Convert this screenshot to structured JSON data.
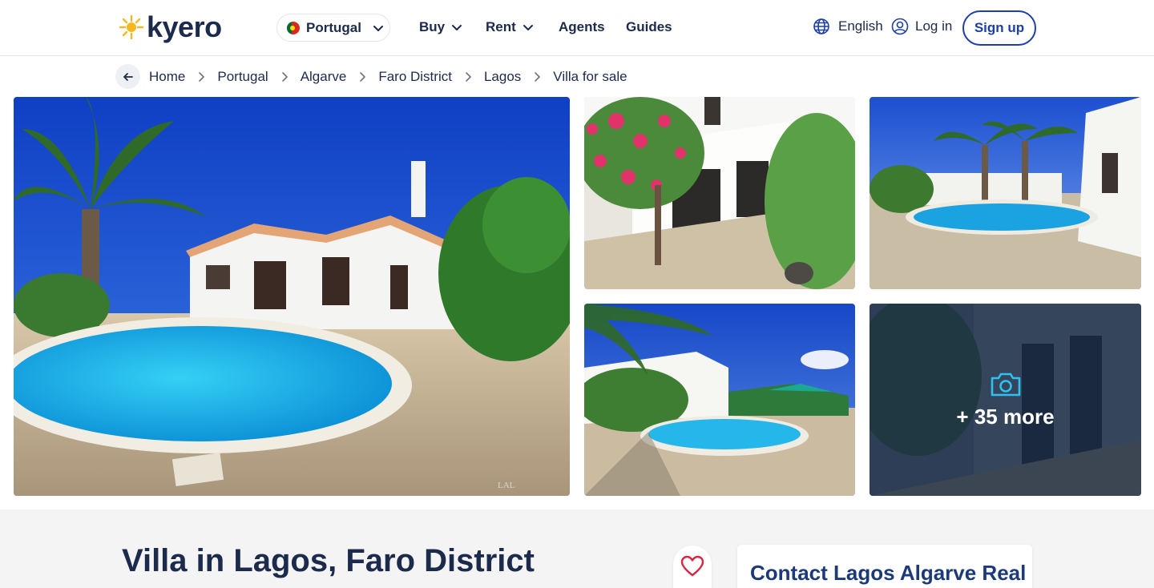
{
  "header": {
    "logo_text": "kyero",
    "country": "Portugal",
    "nav": [
      {
        "label": "Buy",
        "has_dropdown": true
      },
      {
        "label": "Rent",
        "has_dropdown": true
      },
      {
        "label": "Agents",
        "has_dropdown": false
      },
      {
        "label": "Guides",
        "has_dropdown": false
      }
    ],
    "language": "English",
    "login": "Log in",
    "signup": "Sign up"
  },
  "breadcrumb": {
    "items": [
      "Home",
      "Portugal",
      "Algarve",
      "Faro District",
      "Lagos",
      "Villa for sale"
    ]
  },
  "gallery": {
    "more_label": "+ 35 more",
    "watermark": "LAL"
  },
  "listing": {
    "title": "Villa in Lagos, Faro District"
  },
  "contact": {
    "title": "Contact Lagos Algarve Real"
  },
  "colors": {
    "brand_navy": "#1c2a4b",
    "accent_blue": "#1c3fa8",
    "logo_yellow": "#f5b820",
    "favorite_red": "#d9263e"
  },
  "icons": {
    "logo": "sun-icon",
    "back": "arrow-left-icon",
    "separator": "chevron-right-icon",
    "dropdown": "chevron-down-icon",
    "language": "globe-icon",
    "account": "user-circle-icon",
    "gallery_more": "camera-icon",
    "favorite": "heart-icon"
  }
}
